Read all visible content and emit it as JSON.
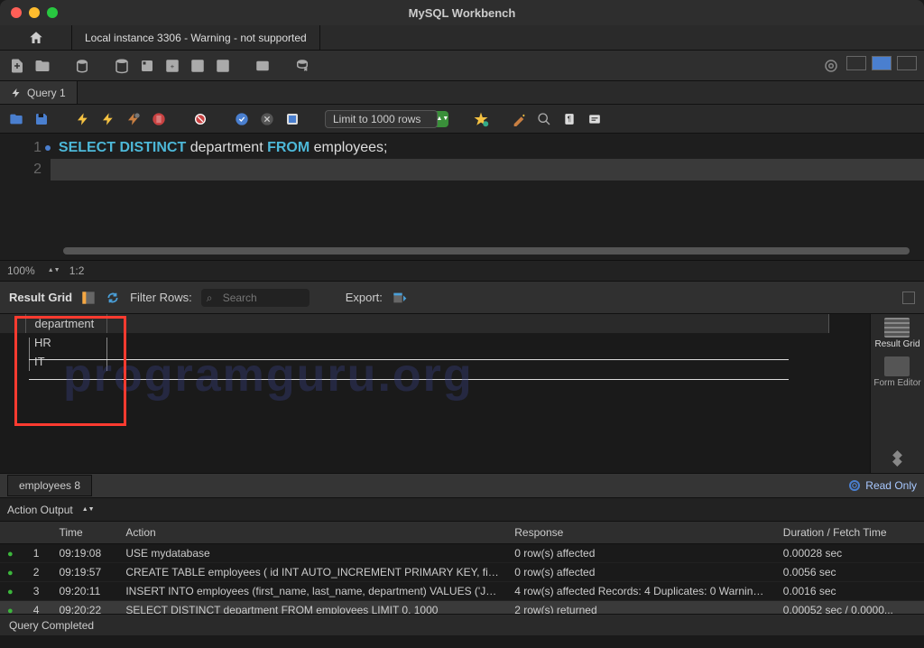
{
  "window": {
    "title": "MySQL Workbench"
  },
  "connection_tab": "Local instance 3306 - Warning - not supported",
  "query_tab": {
    "label": "Query 1"
  },
  "sql_toolbar": {
    "limit_label": "Limit to 1000 rows"
  },
  "editor": {
    "line_numbers": [
      "1",
      "2"
    ],
    "code": {
      "k1": "SELECT",
      "k2": "DISTINCT",
      "id1": "department",
      "k3": "FROM",
      "id2": "employees",
      "semi": ";"
    }
  },
  "zoom": {
    "pct": "100%",
    "pos": "1:2"
  },
  "result_bar": {
    "title": "Result Grid",
    "filter_label": "Filter Rows:",
    "filter_placeholder": "Search",
    "export_label": "Export:"
  },
  "result_grid": {
    "column": "department",
    "rows": [
      "HR",
      "IT"
    ]
  },
  "watermark": "programguru.org",
  "side_panel": {
    "result_grid": "Result Grid",
    "form_editor": "Form Editor"
  },
  "result_tab": {
    "label": "employees 8",
    "readonly": "Read Only"
  },
  "action_output": {
    "title": "Action Output",
    "headers": {
      "time": "Time",
      "action": "Action",
      "response": "Response",
      "duration": "Duration / Fetch Time"
    },
    "rows": [
      {
        "n": "1",
        "time": "09:19:08",
        "action": "USE mydatabase",
        "response": "0 row(s) affected",
        "duration": "0.00028 sec"
      },
      {
        "n": "2",
        "time": "09:19:57",
        "action": "CREATE TABLE employees (     id INT AUTO_INCREMENT PRIMARY KEY,     firs...",
        "response": "0 row(s) affected",
        "duration": "0.0056 sec"
      },
      {
        "n": "3",
        "time": "09:20:11",
        "action": "INSERT INTO employees (first_name, last_name, department) VALUES ('John',...",
        "response": "4 row(s) affected Records: 4  Duplicates: 0  Warnings...",
        "duration": "0.0016 sec"
      },
      {
        "n": "4",
        "time": "09:20:22",
        "action": "SELECT DISTINCT department FROM employees LIMIT 0, 1000",
        "response": "2 row(s) returned",
        "duration": "0.00052 sec / 0.0000..."
      }
    ]
  },
  "status": "Query Completed"
}
